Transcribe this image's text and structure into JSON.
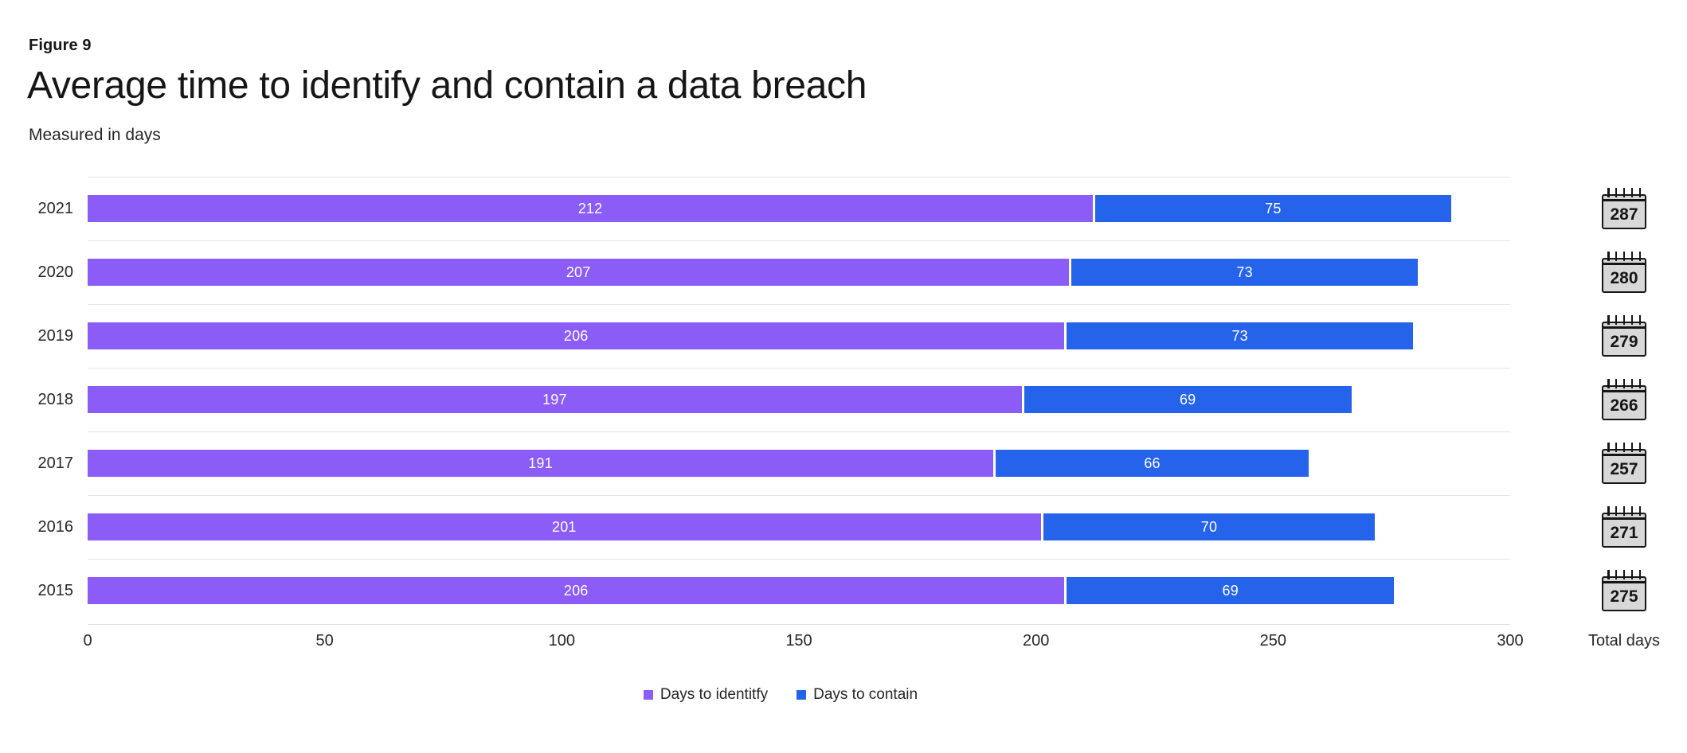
{
  "header": {
    "figure_label": "Figure 9",
    "title": "Average time to identify and contain a data breach",
    "subtitle": "Measured in days"
  },
  "totals_caption": "Total days",
  "legend": [
    {
      "label": "Days to identitfy",
      "color": "#8b5cf6",
      "key": "identify"
    },
    {
      "label": "Days to contain",
      "color": "#2563eb",
      "key": "contain"
    }
  ],
  "axis": {
    "ticks": [
      "0",
      "50",
      "100",
      "150",
      "200",
      "250",
      "300"
    ],
    "min": 0,
    "max": 300
  },
  "chart_data": {
    "type": "bar",
    "title": "Average time to identify and contain a data breach",
    "subtitle": "Measured in days",
    "orientation": "horizontal",
    "stacked": true,
    "xlabel": "",
    "ylabel": "",
    "xlim": [
      0,
      300
    ],
    "grid": true,
    "legend_position": "bottom",
    "categories": [
      "2021",
      "2020",
      "2019",
      "2018",
      "2017",
      "2016",
      "2015"
    ],
    "series": [
      {
        "name": "Days to identitfy",
        "color": "#8b5cf6",
        "values": [
          212,
          207,
          206,
          197,
          191,
          201,
          206
        ]
      },
      {
        "name": "Days to contain",
        "color": "#2563eb",
        "values": [
          75,
          73,
          73,
          69,
          66,
          70,
          69
        ]
      }
    ],
    "totals": [
      287,
      280,
      279,
      266,
      257,
      271,
      275
    ],
    "xticks": [
      0,
      50,
      100,
      150,
      200,
      250,
      300
    ]
  }
}
